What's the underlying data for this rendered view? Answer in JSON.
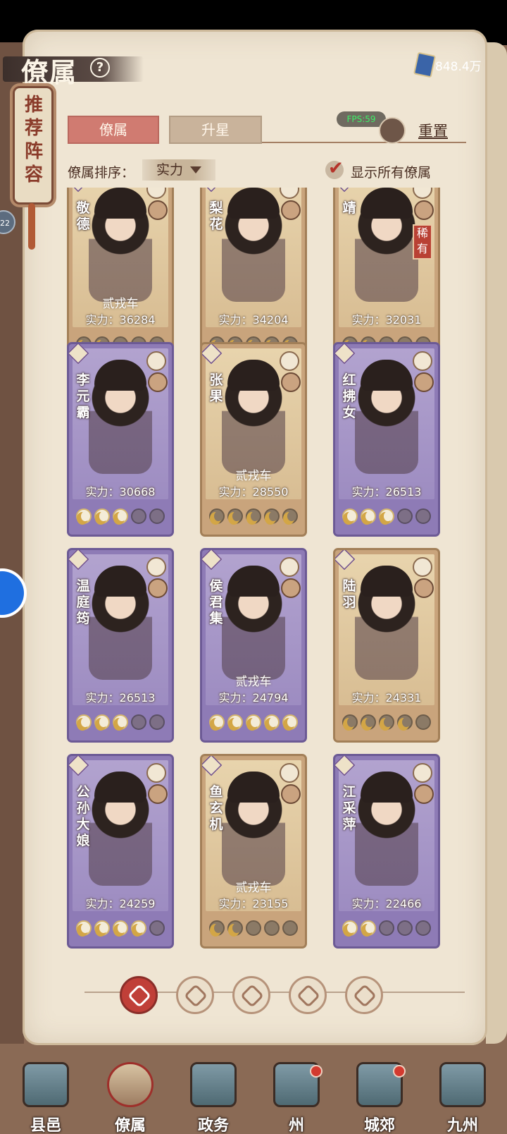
{
  "header": {
    "title": "僚属",
    "help_icon": "question-circle-icon",
    "currency_value": "848.4万",
    "currency_icon": "book-currency-icon"
  },
  "sidebar_banner": {
    "label_lines": [
      "推",
      "荐",
      "阵",
      "容"
    ],
    "side_badge": "22"
  },
  "tabs": [
    {
      "label": "僚属",
      "active": true
    },
    {
      "label": "升星",
      "active": false
    }
  ],
  "fps": "FPS:59",
  "reset_label": "重置",
  "sort": {
    "label": "僚属排序：",
    "selected": "实力"
  },
  "show_all": {
    "label": "显示所有僚属",
    "checked": true
  },
  "cards": [
    {
      "name": "敬德",
      "rank": "贰戎车",
      "power": "实力：36284",
      "stars_filled": 2,
      "stars_total": 5,
      "frame": "gold",
      "rare": ""
    },
    {
      "name": "梨花",
      "rank": "",
      "power": "实力：34204",
      "stars_filled": 5,
      "stars_total": 5,
      "frame": "gold",
      "rare": ""
    },
    {
      "name": "靖",
      "rank": "",
      "power": "实力：32031",
      "stars_filled": 2,
      "stars_total": 5,
      "frame": "gold",
      "rare": "稀有"
    },
    {
      "name": "李元霸",
      "rank": "",
      "power": "实力：30668",
      "stars_filled": 3,
      "stars_total": 5,
      "frame": "purple",
      "rare": ""
    },
    {
      "name": "张果",
      "rank": "贰戎车",
      "power": "实力：28550",
      "stars_filled": 5,
      "stars_total": 5,
      "frame": "gold",
      "rare": ""
    },
    {
      "name": "红拂女",
      "rank": "",
      "power": "实力：26513",
      "stars_filled": 3,
      "stars_total": 5,
      "frame": "purple",
      "rare": ""
    },
    {
      "name": "温庭筠",
      "rank": "",
      "power": "实力：26513",
      "stars_filled": 3,
      "stars_total": 5,
      "frame": "purple",
      "rare": ""
    },
    {
      "name": "侯君集",
      "rank": "贰戎车",
      "power": "实力：24794",
      "stars_filled": 5,
      "stars_total": 5,
      "frame": "purple",
      "rare": ""
    },
    {
      "name": "陆羽",
      "rank": "",
      "power": "实力：24331",
      "stars_filled": 4,
      "stars_total": 5,
      "frame": "gold",
      "rare": ""
    },
    {
      "name": "公孙大娘",
      "rank": "",
      "power": "实力：24259",
      "stars_filled": 4,
      "stars_total": 5,
      "frame": "purple",
      "rare": ""
    },
    {
      "name": "鱼玄机",
      "rank": "贰戎车",
      "power": "实力：23155",
      "stars_filled": 2,
      "stars_total": 5,
      "frame": "gold",
      "rare": ""
    },
    {
      "name": "江采萍",
      "rank": "",
      "power": "实力：22466",
      "stars_filled": 2,
      "stars_total": 5,
      "frame": "purple",
      "rare": ""
    }
  ],
  "filters": [
    {
      "icon": "all-diamond-icon",
      "active": true
    },
    {
      "icon": "military-bell-icon",
      "active": false
    },
    {
      "icon": "beast-icon",
      "active": false
    },
    {
      "icon": "fan-icon",
      "active": false
    },
    {
      "icon": "lion-icon",
      "active": false
    }
  ],
  "bottom_nav": [
    {
      "label": "县邑",
      "icon": "city-gate-icon",
      "active": false,
      "dot": false
    },
    {
      "label": "僚属",
      "icon": "scroll-portrait-icon",
      "active": true,
      "dot": false
    },
    {
      "label": "政务",
      "icon": "documents-icon",
      "active": false,
      "dot": false
    },
    {
      "label": "州",
      "icon": "mountain-icon",
      "active": false,
      "dot": true
    },
    {
      "label": "城郊",
      "icon": "suburb-icon",
      "active": false,
      "dot": true
    },
    {
      "label": "九州",
      "icon": "map-scroll-icon",
      "active": false,
      "dot": false
    }
  ]
}
